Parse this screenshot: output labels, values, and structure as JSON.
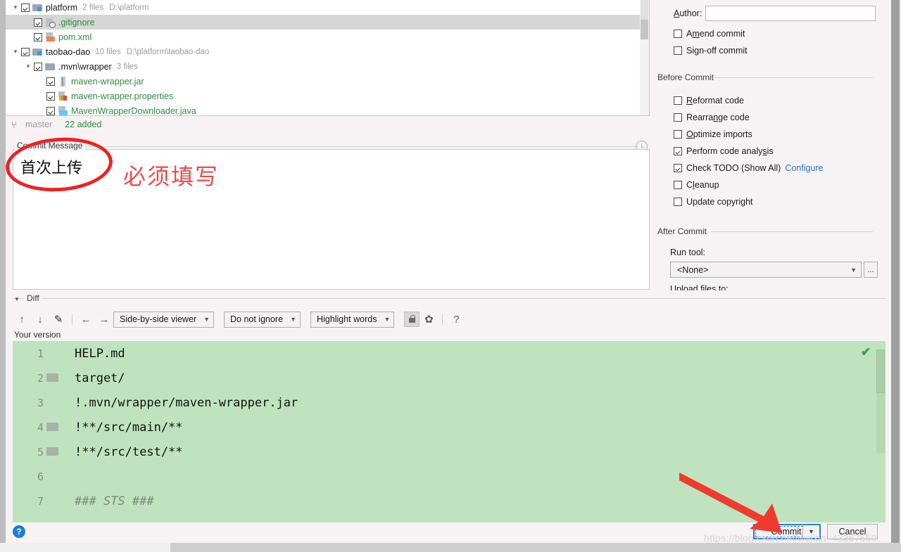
{
  "file_tree": {
    "rows": [
      {
        "indent": 0,
        "twisty": "▾",
        "checked": true,
        "icon": "module-icon",
        "name": "platform",
        "name_color": "black",
        "meta1": "2 files",
        "meta2": "D:\\platform",
        "selected": false
      },
      {
        "indent": 1,
        "twisty": "",
        "checked": true,
        "icon": "gitignore-file-icon",
        "name": ".gitignore",
        "name_color": "green",
        "meta1": "",
        "meta2": "",
        "selected": true
      },
      {
        "indent": 1,
        "twisty": "",
        "checked": true,
        "icon": "xml-file-icon",
        "name": "pom.xml",
        "name_color": "green",
        "meta1": "",
        "meta2": "",
        "selected": false
      },
      {
        "indent": 0,
        "twisty": "▾",
        "checked": true,
        "icon": "module-icon",
        "name": "taobao-dao",
        "name_color": "black",
        "meta1": "10 files",
        "meta2": "D:\\platform\\taobao-dao",
        "selected": false
      },
      {
        "indent": 1,
        "twisty": "▾",
        "checked": true,
        "icon": "folder-icon",
        "name": ".mvn\\wrapper",
        "name_color": "black",
        "meta1": "3 files",
        "meta2": "",
        "selected": false
      },
      {
        "indent": 2,
        "twisty": "",
        "checked": true,
        "icon": "jar-file-icon",
        "name": "maven-wrapper.jar",
        "name_color": "green",
        "meta1": "",
        "meta2": "",
        "selected": false
      },
      {
        "indent": 2,
        "twisty": "",
        "checked": true,
        "icon": "properties-file-icon",
        "name": "maven-wrapper.properties",
        "name_color": "green",
        "meta1": "",
        "meta2": "",
        "selected": false
      },
      {
        "indent": 2,
        "twisty": "",
        "checked": true,
        "icon": "java-file-icon",
        "name": "MavenWrapperDownloader.java",
        "name_color": "green",
        "meta1": "",
        "meta2": "",
        "selected": false
      }
    ]
  },
  "branch_bar": {
    "icon": "git-branch-icon",
    "branch": "master",
    "changes": "22 added"
  },
  "commit_message": {
    "legend": "Commit Message",
    "value": "首次上传",
    "history_icon": "clock-icon"
  },
  "annotations": {
    "ellipse": "red-ellipse-annotation",
    "text": "必须填写",
    "arrow": "red-arrow-annotation",
    "color": "#ee2222"
  },
  "options": {
    "author_label": "Author:",
    "author_value": "",
    "author_placeholder": "",
    "checks_top": [
      {
        "label_pre": "A",
        "label_mn": "m",
        "label_post": "end commit",
        "checked": false
      },
      {
        "label_pre": "Si",
        "label_mn": "g",
        "label_post": "n-off commit",
        "checked": false
      }
    ],
    "before_commit_title": "Before Commit",
    "before_commit": [
      {
        "label_pre": "",
        "label_mn": "R",
        "label_post": "eformat code",
        "checked": false
      },
      {
        "label_pre": "Rearra",
        "label_mn": "n",
        "label_post": "ge code",
        "checked": false
      },
      {
        "label_pre": "",
        "label_mn": "O",
        "label_post": "ptimize imports",
        "checked": false
      },
      {
        "label_pre": "Perform code analy",
        "label_mn": "s",
        "label_post": "is",
        "checked": true
      },
      {
        "label_pre": "Check TODO (Show All)",
        "label_mn": "",
        "label_post": "",
        "checked": true,
        "link": "Configure"
      },
      {
        "label_pre": "C",
        "label_mn": "l",
        "label_post": "eanup",
        "checked": false
      },
      {
        "label_pre": "Update copyright",
        "label_mn": "",
        "label_post": "",
        "checked": false
      }
    ],
    "after_commit_title": "After Commit",
    "run_tool_label": "Run tool:",
    "run_tool_value": "<None>",
    "browse_button": "...",
    "clipped_label": "Upload files to:"
  },
  "diff": {
    "legend": "Diff",
    "toolbar": {
      "prev_icon": "arrow-up-icon",
      "next_icon": "arrow-down-icon",
      "edit_icon": "pencil-icon",
      "left_icon": "arrow-left-icon",
      "right_icon": "arrow-right-icon",
      "viewer_mode": "Side-by-side viewer",
      "ignore_mode": "Do not ignore",
      "highlight_mode": "Highlight words",
      "lock_icon": "lock-icon",
      "settings_icon": "gear-icon",
      "help_icon": "question-mark-icon"
    },
    "version_label": "Your version",
    "lines": [
      {
        "num": "1",
        "folder": false,
        "text": "HELP.md",
        "style": "normal"
      },
      {
        "num": "2",
        "folder": true,
        "text": "target/",
        "style": "normal"
      },
      {
        "num": "3",
        "folder": false,
        "text": "!.mvn/wrapper/maven-wrapper.jar",
        "style": "normal"
      },
      {
        "num": "4",
        "folder": true,
        "text": "!**/src/main/**",
        "style": "normal"
      },
      {
        "num": "5",
        "folder": true,
        "text": "!**/src/test/**",
        "style": "normal"
      },
      {
        "num": "6",
        "folder": false,
        "text": "",
        "style": "normal"
      },
      {
        "num": "7",
        "folder": false,
        "text": "### STS ###",
        "style": "comment"
      }
    ],
    "status_icon": "green-check-icon",
    "added_color": "#bfe3bf"
  },
  "footer": {
    "help_icon": "help-icon",
    "help_glyph": "?",
    "commit_button": "Commit",
    "commit_dropdown_icon": "chevron-down-icon",
    "cancel_button": "Cancel",
    "watermark": "https://blog.csdn.net/weixin_43367550"
  }
}
